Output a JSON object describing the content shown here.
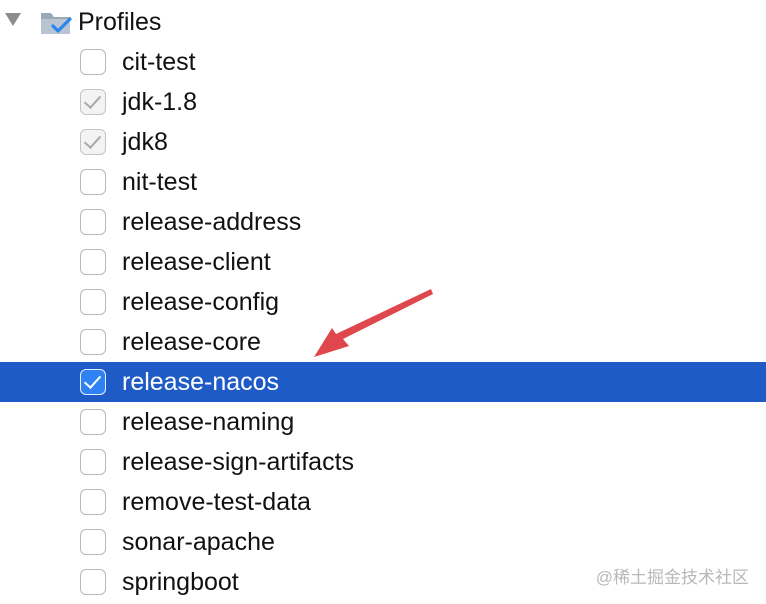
{
  "header": {
    "label": "Profiles",
    "expand_icon": "triangle-down-icon",
    "folder_icon": "folder-check-icon"
  },
  "profiles": [
    {
      "label": "cit-test",
      "state": "unchecked"
    },
    {
      "label": "jdk-1.8",
      "state": "checked-disabled"
    },
    {
      "label": "jdk8",
      "state": "checked-disabled"
    },
    {
      "label": "nit-test",
      "state": "unchecked"
    },
    {
      "label": "release-address",
      "state": "unchecked"
    },
    {
      "label": "release-client",
      "state": "unchecked"
    },
    {
      "label": "release-config",
      "state": "unchecked"
    },
    {
      "label": "release-core",
      "state": "unchecked"
    },
    {
      "label": "release-nacos",
      "state": "checked-active",
      "selected": true
    },
    {
      "label": "release-naming",
      "state": "unchecked"
    },
    {
      "label": "release-sign-artifacts",
      "state": "unchecked"
    },
    {
      "label": "remove-test-data",
      "state": "unchecked"
    },
    {
      "label": "sonar-apache",
      "state": "unchecked"
    },
    {
      "label": "springboot",
      "state": "unchecked"
    }
  ],
  "watermark": "@稀土掘金技术社区",
  "colors": {
    "selection": "#1f5bc7",
    "checkbox_active": "#2f82f3",
    "annotation_arrow": "#e0474c"
  }
}
